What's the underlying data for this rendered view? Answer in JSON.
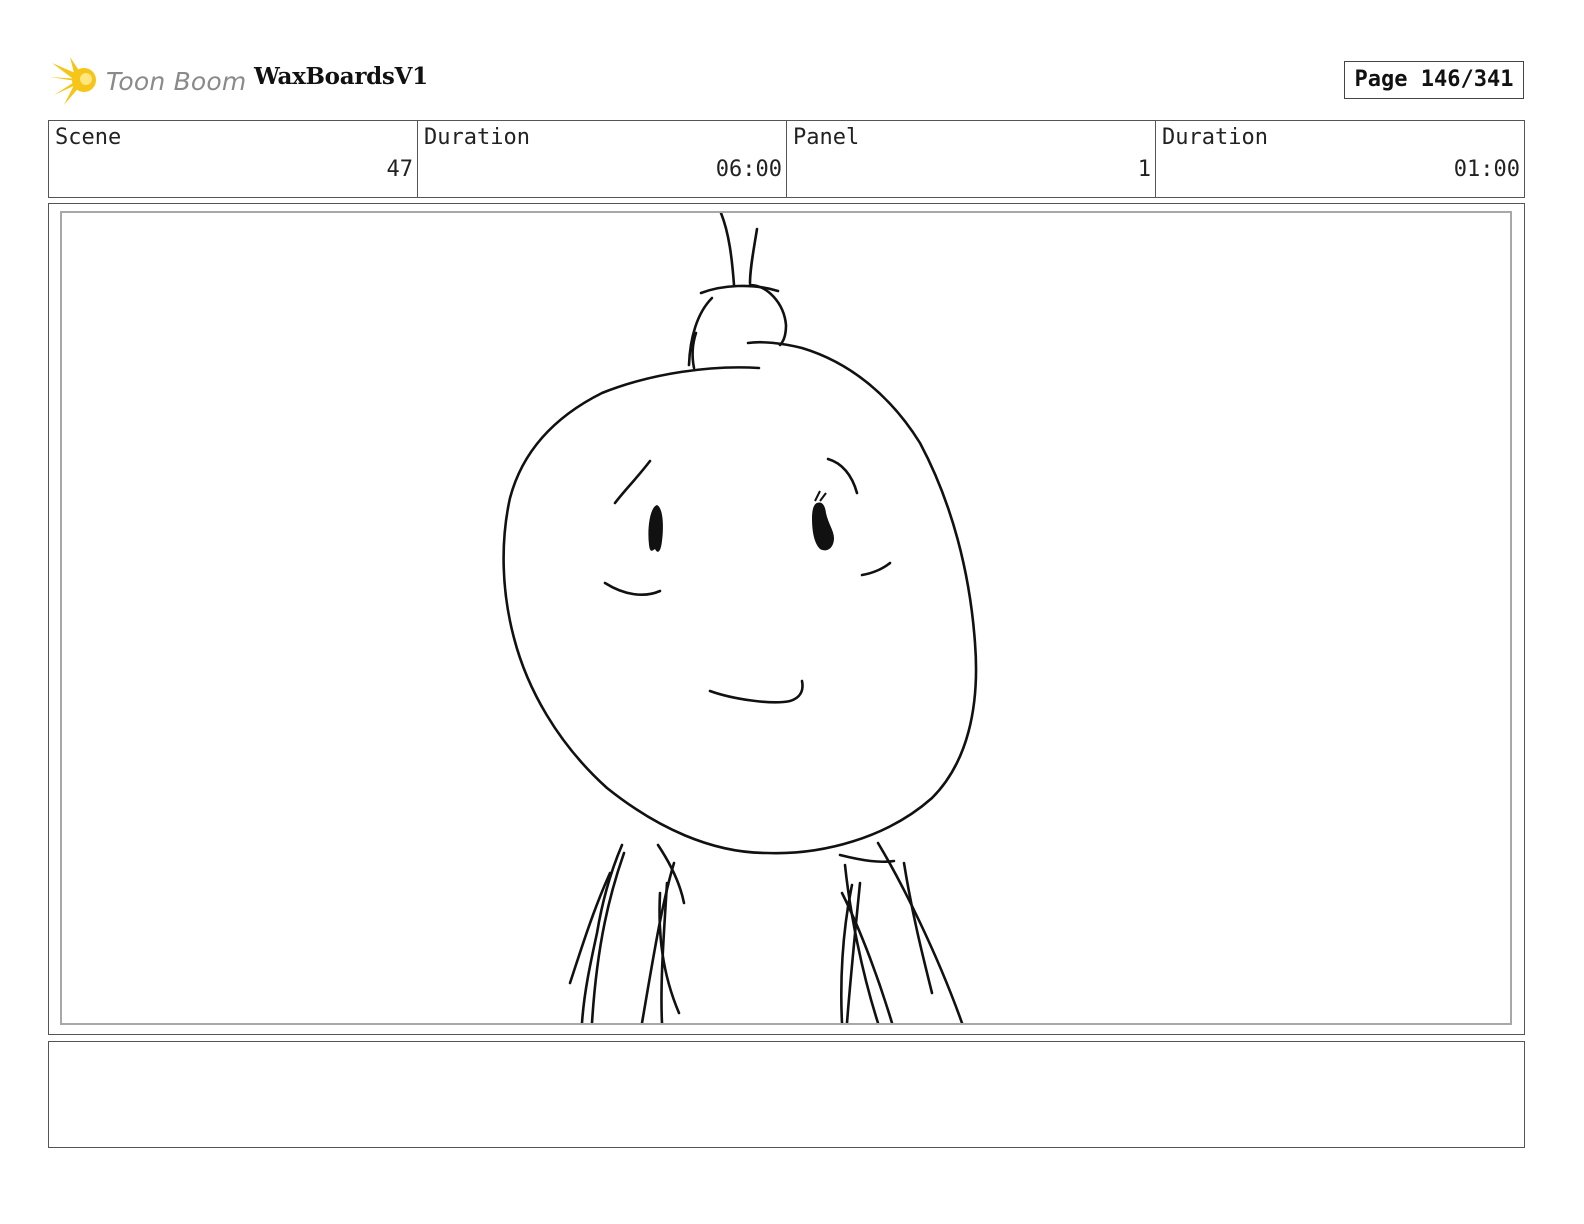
{
  "header": {
    "logo_text": "Toon Boom",
    "project_title": "WaxBoardsV1",
    "page_label": "Page 146/341"
  },
  "info": {
    "scene_label": "Scene",
    "scene_value": "47",
    "scene_duration_label": "Duration",
    "scene_duration_value": "06:00",
    "panel_label": "Panel",
    "panel_value": "1",
    "panel_duration_label": "Duration",
    "panel_duration_value": "01:00"
  },
  "panel": {
    "drawing": "sketch-character-face"
  },
  "notes": {
    "text": ""
  },
  "colors": {
    "logo_star": "#f5c518",
    "logo_text": "#8a8a8a",
    "border": "#555555",
    "inner_frame": "#a8a8a8"
  }
}
